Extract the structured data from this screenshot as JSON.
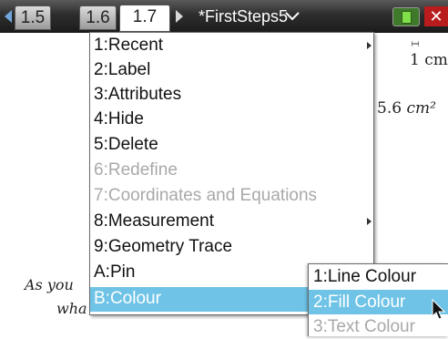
{
  "topbar": {
    "tabs": [
      {
        "label": "1.5",
        "active": false
      },
      {
        "label": "1.6",
        "active": false
      },
      {
        "label": "1.7",
        "active": true
      }
    ],
    "document_title": "*FirstSteps5",
    "icons": [
      "nav-left-arrow-icon",
      "nav-right-arrow-icon",
      "chevron-down-icon",
      "battery-icon",
      "close-icon"
    ],
    "accent_color": "#6ec3e6"
  },
  "document": {
    "scale_label": "1 cm",
    "area_value": "5.6",
    "area_unit": "cm²",
    "text_line1": "As you",
    "text_line2": "wha"
  },
  "menu": {
    "items": [
      {
        "label": "1:Recent",
        "submenu": true,
        "state": "normal"
      },
      {
        "label": "2:Label",
        "submenu": false,
        "state": "normal"
      },
      {
        "label": "3:Attributes",
        "submenu": false,
        "state": "normal"
      },
      {
        "label": "4:Hide",
        "submenu": false,
        "state": "normal"
      },
      {
        "label": "5:Delete",
        "submenu": false,
        "state": "normal"
      },
      {
        "label": "6:Redefine",
        "submenu": false,
        "state": "disabled"
      },
      {
        "label": "7:Coordinates and Equations",
        "submenu": false,
        "state": "disabled"
      },
      {
        "label": "8:Measurement",
        "submenu": true,
        "state": "normal"
      },
      {
        "label": "9:Geometry Trace",
        "submenu": false,
        "state": "normal"
      },
      {
        "label": "A:Pin",
        "submenu": false,
        "state": "normal"
      },
      {
        "label": "B:Colour",
        "submenu": true,
        "state": "selected"
      }
    ]
  },
  "submenu": {
    "items": [
      {
        "label": "1:Line Colour",
        "state": "normal"
      },
      {
        "label": "2:Fill Colour",
        "state": "selected"
      },
      {
        "label": "3:Text Colour",
        "state": "disabled"
      }
    ]
  }
}
